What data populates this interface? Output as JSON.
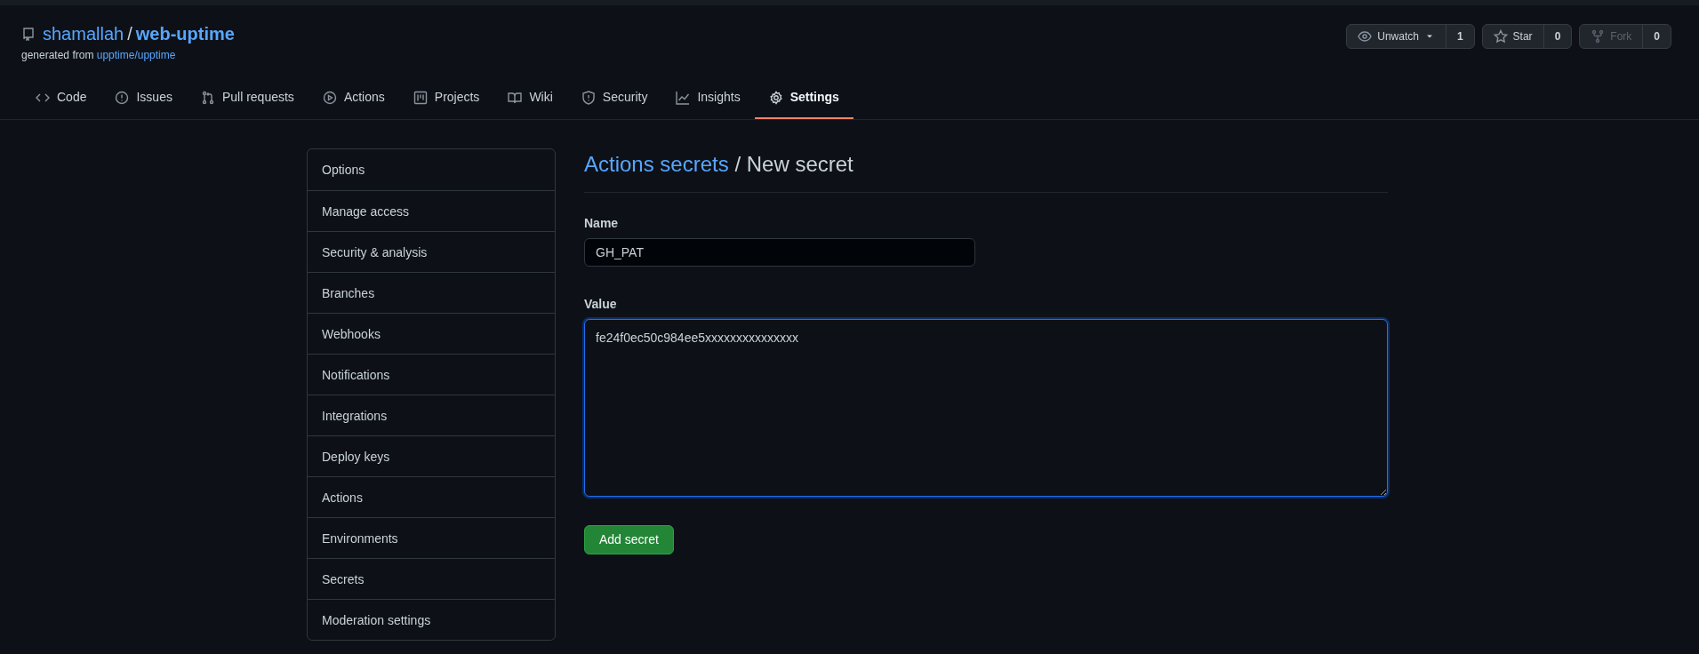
{
  "repo": {
    "owner": "shamallah",
    "separator": "/",
    "name": "web-uptime",
    "generated_prefix": "generated from",
    "template": "upptime/upptime"
  },
  "repo_actions": [
    {
      "label": "Unwatch",
      "count": "1",
      "disabled": false,
      "dropdown": true
    },
    {
      "label": "Star",
      "count": "0",
      "disabled": false,
      "dropdown": false
    },
    {
      "label": "Fork",
      "count": "0",
      "disabled": true,
      "dropdown": false
    }
  ],
  "tabs": [
    {
      "label": "Code",
      "selected": false
    },
    {
      "label": "Issues",
      "selected": false
    },
    {
      "label": "Pull requests",
      "selected": false
    },
    {
      "label": "Actions",
      "selected": false
    },
    {
      "label": "Projects",
      "selected": false
    },
    {
      "label": "Wiki",
      "selected": false
    },
    {
      "label": "Security",
      "selected": false
    },
    {
      "label": "Insights",
      "selected": false
    },
    {
      "label": "Settings",
      "selected": true
    }
  ],
  "sidebar": {
    "items": [
      {
        "label": "Options",
        "selected": false
      },
      {
        "label": "Manage access",
        "selected": false
      },
      {
        "label": "Security & analysis",
        "selected": false
      },
      {
        "label": "Branches",
        "selected": false
      },
      {
        "label": "Webhooks",
        "selected": false
      },
      {
        "label": "Notifications",
        "selected": false
      },
      {
        "label": "Integrations",
        "selected": false
      },
      {
        "label": "Deploy keys",
        "selected": false
      },
      {
        "label": "Actions",
        "selected": false
      },
      {
        "label": "Environments",
        "selected": false
      },
      {
        "label": "Secrets",
        "selected": false
      },
      {
        "label": "Moderation settings",
        "selected": false
      }
    ]
  },
  "form": {
    "breadcrumb_link": "Actions secrets",
    "separator": "/",
    "title": "New secret",
    "name_label": "Name",
    "name_value": "GH_PAT",
    "value_label": "Value",
    "value_value": "fe24f0ec50c984ee5xxxxxxxxxxxxxxx",
    "value_focused": true,
    "submit": "Add secret"
  }
}
